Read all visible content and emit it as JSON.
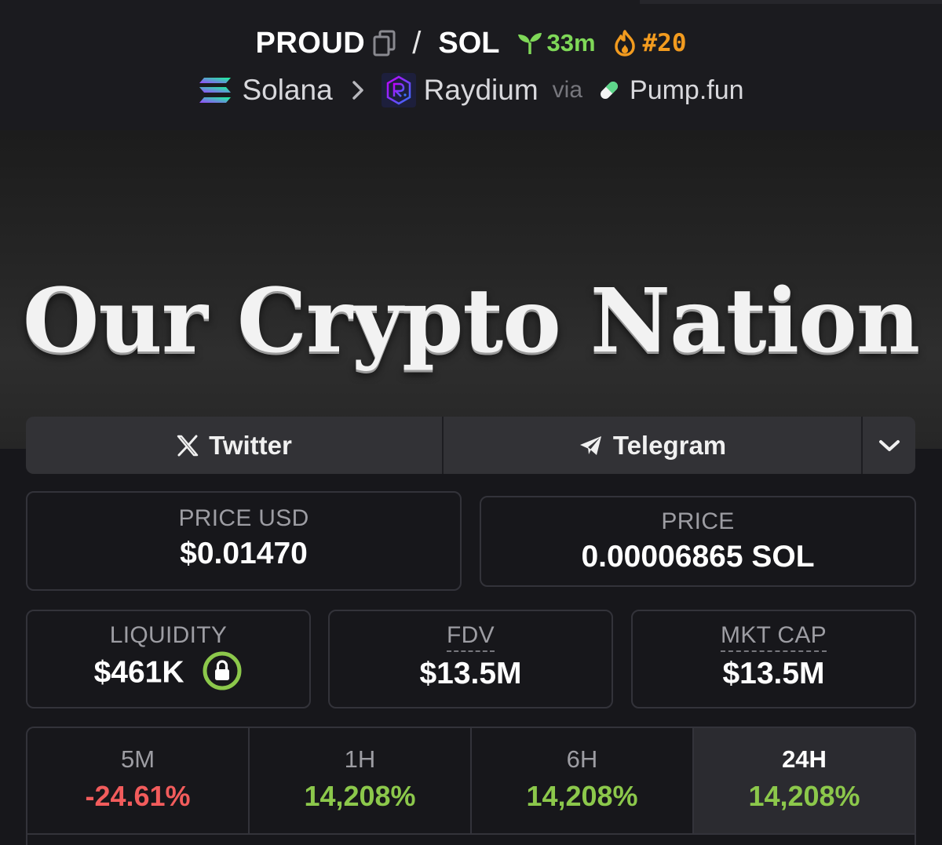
{
  "header": {
    "pair_base": "PROUD",
    "pair_sep": "/",
    "pair_quote": "SOL",
    "age": "33m",
    "rank": "#20",
    "chain": "Solana",
    "dex": "Raydium",
    "via": "via",
    "launchpad": "Pump.fun",
    "colors": {
      "age": "#7fd858",
      "rank": "#f29b1f"
    }
  },
  "banner": {
    "text": "Our Crypto Nation"
  },
  "socials": {
    "twitter": "Twitter",
    "telegram": "Telegram"
  },
  "stats": {
    "price_usd_label": "PRICE USD",
    "price_usd": "$0.01470",
    "price_label": "PRICE",
    "price": "0.00006865 SOL",
    "liquidity_label": "LIQUIDITY",
    "liquidity": "$461K",
    "fdv_label": "FDV",
    "fdv": "$13.5M",
    "mktcap_label": "MKT CAP",
    "mktcap": "$13.5M"
  },
  "timeframes": [
    {
      "label": "5M",
      "change": "-24.61%",
      "trend": "down"
    },
    {
      "label": "1H",
      "change": "14,208%",
      "trend": "up"
    },
    {
      "label": "6H",
      "change": "14,208%",
      "trend": "up"
    },
    {
      "label": "24H",
      "change": "14,208%",
      "trend": "up",
      "active": true
    }
  ]
}
